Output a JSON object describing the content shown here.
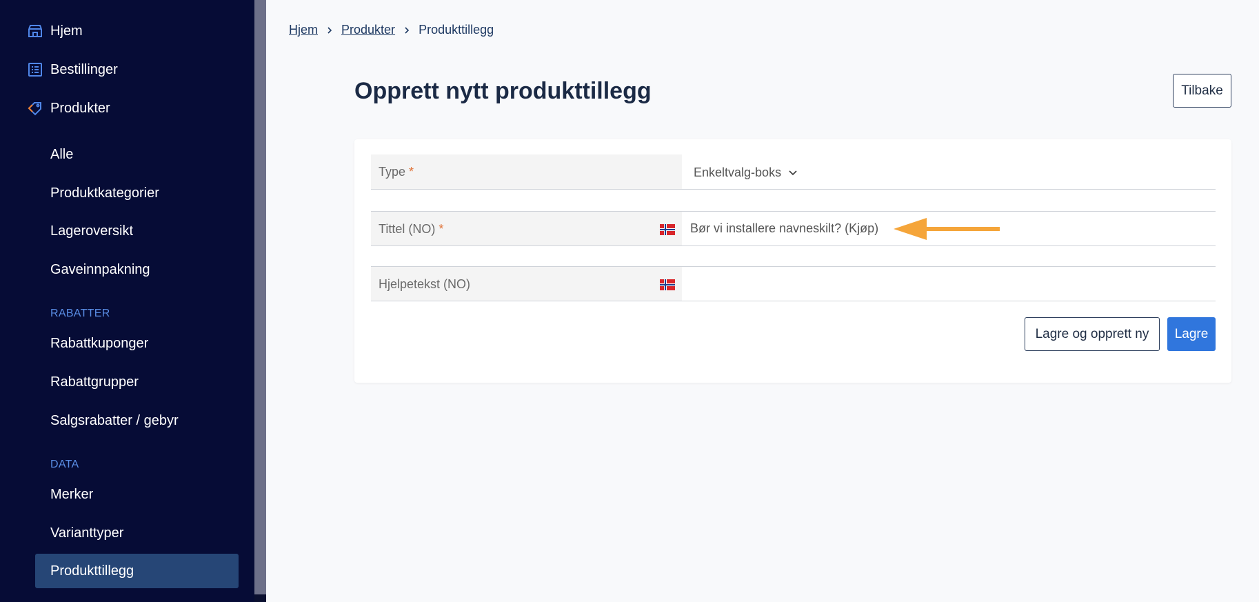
{
  "sidebar": {
    "top_items": [
      {
        "label": "Hjem",
        "icon": "store-icon"
      },
      {
        "label": "Bestillinger",
        "icon": "orders-list-icon"
      },
      {
        "label": "Produkter",
        "icon": "tag-icon"
      }
    ],
    "product_sub_items": [
      "Alle",
      "Produktkategorier",
      "Lageroversikt",
      "Gaveinnpakning"
    ],
    "section_rabatter": "RABATTER",
    "rabatter_items": [
      "Rabattkuponger",
      "Rabattgrupper",
      "Salgsrabatter / gebyr"
    ],
    "section_data": "DATA",
    "data_items": [
      "Merker",
      "Varianttyper",
      "Produkttillegg"
    ],
    "active_item": "Produkttillegg"
  },
  "breadcrumb": {
    "home": "Hjem",
    "products": "Produkter",
    "current": "Produkttillegg"
  },
  "page": {
    "title": "Opprett nytt produkttillegg",
    "back_button": "Tilbake"
  },
  "form": {
    "type": {
      "label": "Type",
      "required_mark": "*",
      "value": "Enkeltvalg-boks"
    },
    "title": {
      "label": "Tittel (NO)",
      "required_mark": "*",
      "value": "Bør vi installere navneskilt? (Kjøp)"
    },
    "help_text": {
      "label": "Hjelpetekst (NO)",
      "value": ""
    },
    "save_and_new_button": "Lagre og opprett ny",
    "save_button": "Lagre"
  },
  "colors": {
    "sidebar_bg": "#060c36",
    "sidebar_active": "#264676",
    "section_label": "#5a8ee6",
    "primary": "#3076dd",
    "required": "#e0743a",
    "annotation_arrow": "#f5a53a"
  }
}
